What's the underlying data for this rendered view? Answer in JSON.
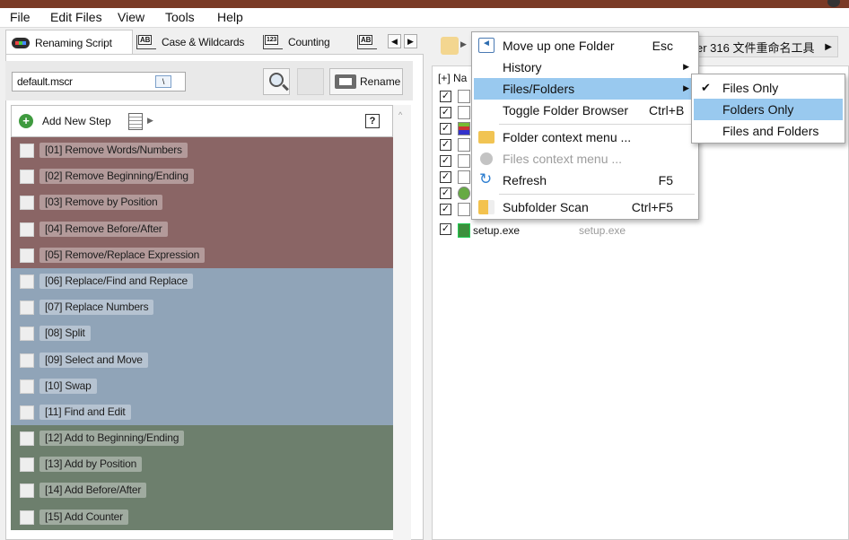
{
  "menubar": {
    "items": [
      "File",
      "Edit Files",
      "View",
      "Tools",
      "Help"
    ]
  },
  "tabs": [
    {
      "label": "Renaming Script",
      "icon": "script-icon"
    },
    {
      "label": "Case & Wildcards",
      "icon": "case-icon"
    },
    {
      "label": "Counting",
      "icon": "counting-icon"
    }
  ],
  "script_file": {
    "value": "default.mscr"
  },
  "rename_button": {
    "label": "Rename"
  },
  "step_header": {
    "add_label": "Add New Step",
    "help_label": "?"
  },
  "steps": [
    {
      "label": "[01]  Remove Words/Numbers",
      "group": "red"
    },
    {
      "label": "[02]  Remove Beginning/Ending",
      "group": "red"
    },
    {
      "label": "[03]  Remove by Position",
      "group": "red"
    },
    {
      "label": "[04]  Remove Before/After",
      "group": "red"
    },
    {
      "label": "[05]  Remove/Replace Expression",
      "group": "red"
    },
    {
      "label": "[06]  Replace/Find and Replace",
      "group": "blue"
    },
    {
      "label": "[07]  Replace Numbers",
      "group": "blue"
    },
    {
      "label": "[08]  Split",
      "group": "blue"
    },
    {
      "label": "[09]  Select and Move",
      "group": "blue"
    },
    {
      "label": "[10]  Swap",
      "group": "blue"
    },
    {
      "label": "[11]  Find and Edit",
      "group": "blue"
    },
    {
      "label": "[12]  Add to Beginning/Ending",
      "group": "green"
    },
    {
      "label": "[13]  Add by Position",
      "group": "green"
    },
    {
      "label": "[14]  Add Before/After",
      "group": "green"
    },
    {
      "label": "[15]  Add Counter",
      "group": "green"
    }
  ],
  "right_panel": {
    "path_label": "er 316 文件重命名工具",
    "file_header": "[+] Na",
    "visible_file": {
      "name": "setup.exe",
      "new_name": "setup.exe"
    }
  },
  "context_menu": {
    "items": [
      {
        "label": "Move up one Folder",
        "shortcut": "Esc",
        "icon": "folder-up-icon"
      },
      {
        "label": "History",
        "submenu": true
      },
      {
        "label": "Files/Folders",
        "submenu": true,
        "highlighted": true
      },
      {
        "label": "Toggle Folder Browser",
        "shortcut": "Ctrl+B"
      },
      {
        "label": "Folder context menu ...",
        "icon": "folder-icon"
      },
      {
        "label": "Files context menu ...",
        "icon": "files-icon",
        "disabled": true
      },
      {
        "label": "Refresh",
        "shortcut": "F5",
        "icon": "refresh-icon"
      },
      {
        "label": "Subfolder Scan",
        "shortcut": "Ctrl+F5",
        "icon": "subfolder-icon"
      }
    ]
  },
  "submenu": {
    "items": [
      {
        "label": "Files Only",
        "checked": true
      },
      {
        "label": "Folders Only",
        "highlighted": true
      },
      {
        "label": "Files and Folders"
      }
    ]
  },
  "colors": {
    "remove_group": "#8a6565",
    "replace_group": "#90a4b8",
    "add_group": "#6d7f6d",
    "menu_highlight": "#99c9ef"
  }
}
